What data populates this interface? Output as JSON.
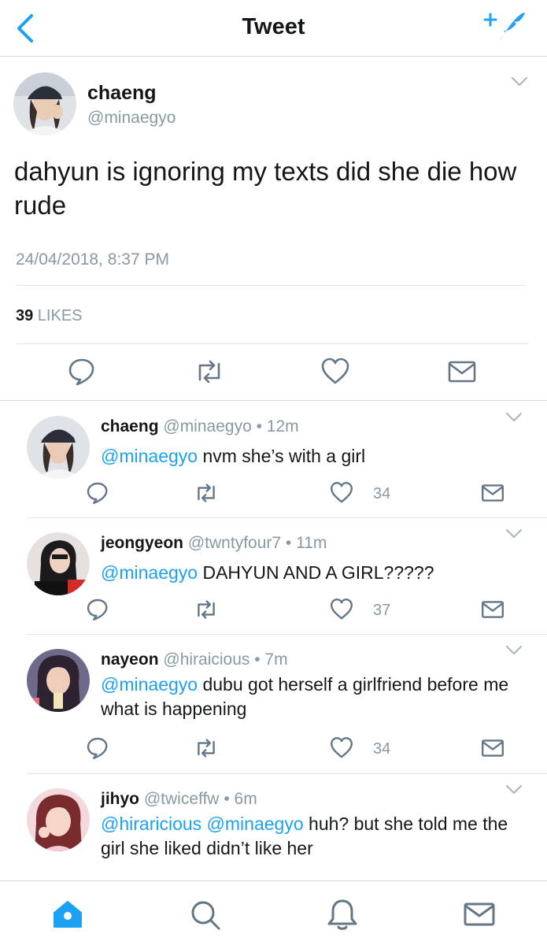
{
  "header": {
    "title": "Tweet",
    "back_icon": "chevron-left-icon",
    "compose_icon": "compose-tweet-icon",
    "accent": "#1da1f2"
  },
  "main_tweet": {
    "name": "chaeng",
    "handle": "@minaegyo",
    "text": "dahyun is ignoring my texts did she die how rude",
    "timestamp": "24/04/2018, 8:37 PM",
    "likes_count": "39",
    "likes_label": "LIKES"
  },
  "replies": [
    {
      "name": "chaeng",
      "handle": "@minaegyo",
      "time": "• 12m",
      "mentions": "@minaegyo",
      "text": " nvm she’s with a girl",
      "likes": "34"
    },
    {
      "name": "jeongyeon",
      "handle": "@twntyfour7",
      "time": "• 11m",
      "mentions": "@minaegyo",
      "text": " DAHYUN AND A GIRL?????",
      "likes": "37"
    },
    {
      "name": "nayeon",
      "handle": "@hiraicious",
      "time": "• 7m",
      "mentions": "@minaegyo",
      "text": " dubu got herself a girlfriend before me what is happening",
      "likes": "34"
    },
    {
      "name": "jihyo",
      "handle": "@twiceffw",
      "time": "• 6m",
      "mentions": "@hiraricious @minaegyo",
      "text": " huh? but she told me the girl she liked didn’t like her",
      "likes": ""
    }
  ],
  "tabbar": [
    "home-icon",
    "search-icon",
    "notifications-icon",
    "messages-icon"
  ],
  "colors": {
    "text": "#14171a",
    "secondary": "#8899a6",
    "accent": "#1da1f2",
    "divider": "#e1e8ed"
  }
}
